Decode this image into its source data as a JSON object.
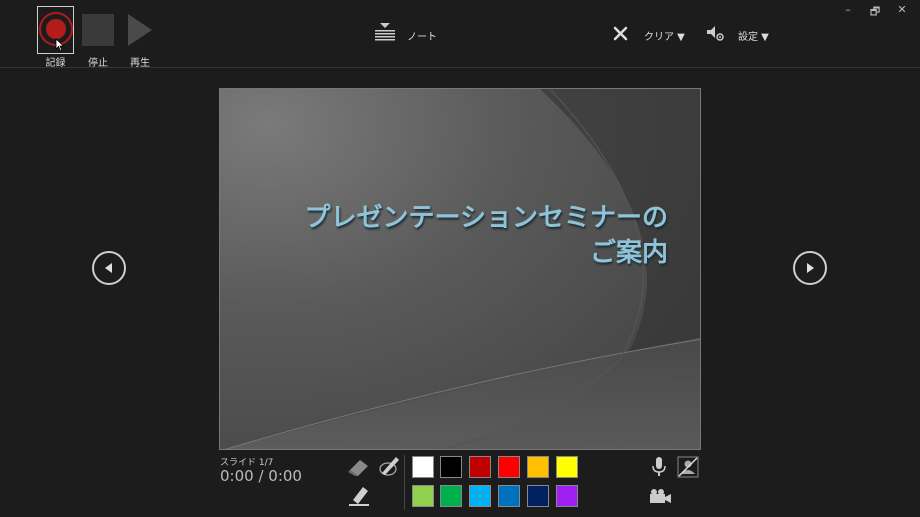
{
  "window_controls": {
    "minimize": "–",
    "restore": "🗗",
    "close": "✕"
  },
  "toolbar": {
    "record_label": "記録",
    "stop_label": "停止",
    "play_label": "再生",
    "notes_label": "ノート",
    "clear_label": "クリア ▼",
    "settings_label": "設定 ▼"
  },
  "slide": {
    "title_line1": "プレゼンテーションセミナーの",
    "title_line2": "ご案内"
  },
  "footer": {
    "slide_counter": "スライド 1/7",
    "timer": "0:00 / 0:00"
  },
  "pen_colors": [
    "#ffffff",
    "#000000",
    "#c00000",
    "#ff0000",
    "#ffc000",
    "#ffff00",
    "#92d050",
    "#00b050",
    "#00b0f0",
    "#0070c0",
    "#002060",
    "#a020f0"
  ],
  "icons": {
    "prev": "chevron-left-icon",
    "next": "chevron-right-icon",
    "eraser": "eraser-icon",
    "pen": "pen-icon",
    "highlighter": "highlighter-icon",
    "microphone": "microphone-icon",
    "camera_off": "camera-off-icon",
    "video_camera": "video-camera-icon",
    "clear": "x-icon",
    "settings": "speaker-gear-icon",
    "notes": "notes-icon"
  }
}
